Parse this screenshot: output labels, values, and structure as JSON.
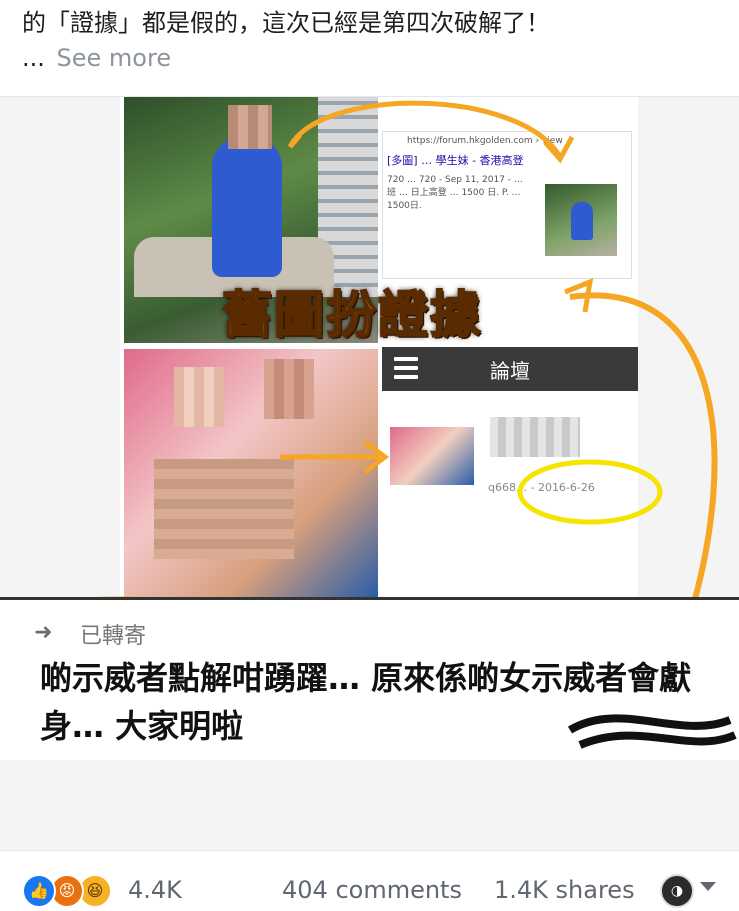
{
  "post": {
    "text": "的「證據」都是假的，這次已經是第四次破解了！",
    "ellipsis": "...",
    "see_more": "See more"
  },
  "image": {
    "caption": "舊圖扮證據",
    "forum": {
      "url": "https://forum.hkgolden.com › view",
      "title": "[多圖] … 學生妹 - 香港高登",
      "snippet": "720 … 720 - Sep 11, 2017 - … 班 … 日上高登 … 1500 日. P. … 1500日."
    },
    "app": {
      "title": "論壇",
      "user_date": "q668… - 2016-6-26"
    },
    "shared": {
      "label": "已轉寄",
      "body": "啲示威者點解咁踴躍… 原來係啲女示威者會獻身… 大家明啦"
    },
    "colors": {
      "highlight_orange": "#f5a623",
      "highlight_yellow": "#f5e400"
    }
  },
  "footer": {
    "reactions": [
      "like-icon",
      "angry-icon",
      "haha-icon"
    ],
    "reaction_count": "4.4K",
    "comments": "404 comments",
    "shares": "1.4K shares"
  }
}
